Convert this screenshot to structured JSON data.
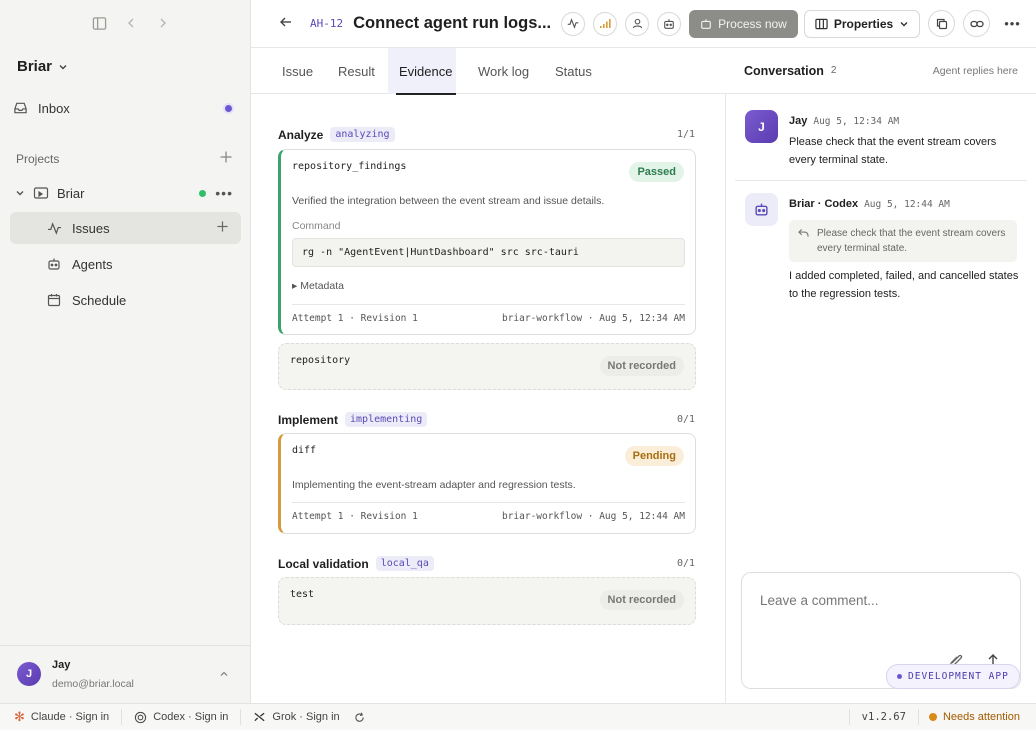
{
  "sidebar": {
    "workspace": "Briar",
    "inbox": "Inbox",
    "projects_label": "Projects",
    "project_name": "Briar",
    "items": [
      {
        "label": "Issues"
      },
      {
        "label": "Agents"
      },
      {
        "label": "Schedule"
      }
    ],
    "user": {
      "initial": "J",
      "name": "Jay",
      "email": "demo@briar.local"
    }
  },
  "header": {
    "issue_id": "AH-12",
    "title": "Connect agent run logs...",
    "process_label": "Process now",
    "properties_label": "Properties"
  },
  "tabs": [
    "Issue",
    "Result",
    "Evidence",
    "Work log",
    "Status"
  ],
  "evidence": {
    "analyze": {
      "title": "Analyze",
      "tag": "analyzing",
      "count": "1/1",
      "card": {
        "name": "repository_findings",
        "badge": "Passed",
        "desc": "Verified the integration between the event stream and issue details.",
        "command_label": "Command",
        "command": "rg -n \"AgentEvent|HuntDashboard\" src src-tauri",
        "metadata": "Metadata",
        "attempt": "Attempt 1 · Revision 1",
        "source": "briar-workflow · Aug 5, 12:34 AM"
      },
      "ghost": {
        "name": "repository",
        "badge": "Not recorded"
      }
    },
    "implement": {
      "title": "Implement",
      "tag": "implementing",
      "count": "0/1",
      "card": {
        "name": "diff",
        "badge": "Pending",
        "desc": "Implementing the event-stream adapter and regression tests.",
        "attempt": "Attempt 1 · Revision 1",
        "source": "briar-workflow · Aug 5, 12:44 AM"
      }
    },
    "validation": {
      "title": "Local validation",
      "tag": "local_qa",
      "count": "0/1",
      "ghost": {
        "name": "test",
        "badge": "Not recorded"
      }
    }
  },
  "conversation": {
    "title": "Conversation",
    "count": "2",
    "hint": "Agent replies here",
    "messages": [
      {
        "initial": "J",
        "author": "Jay",
        "time": "Aug 5, 12:34 AM",
        "text": "Please check that the event stream covers every terminal state."
      },
      {
        "author": "Briar · Codex",
        "time": "Aug 5, 12:44 AM",
        "quote": "Please check that the event stream covers every terminal state.",
        "text": "I added completed, failed, and cancelled states to the regression tests."
      }
    ],
    "composer_placeholder": "Leave a comment...",
    "dev_badge": "DEVELOPMENT APP"
  },
  "statusbar": {
    "claude": "Claude · Sign in",
    "codex": "Codex · Sign in",
    "grok": "Grok · Sign in",
    "version": "v1.2.67",
    "attention": "Needs attention"
  },
  "colors": {
    "accent": "#6b57d6",
    "passed": "#3aa36a",
    "pending": "#d79a3a",
    "online": "#2fbf6b"
  }
}
